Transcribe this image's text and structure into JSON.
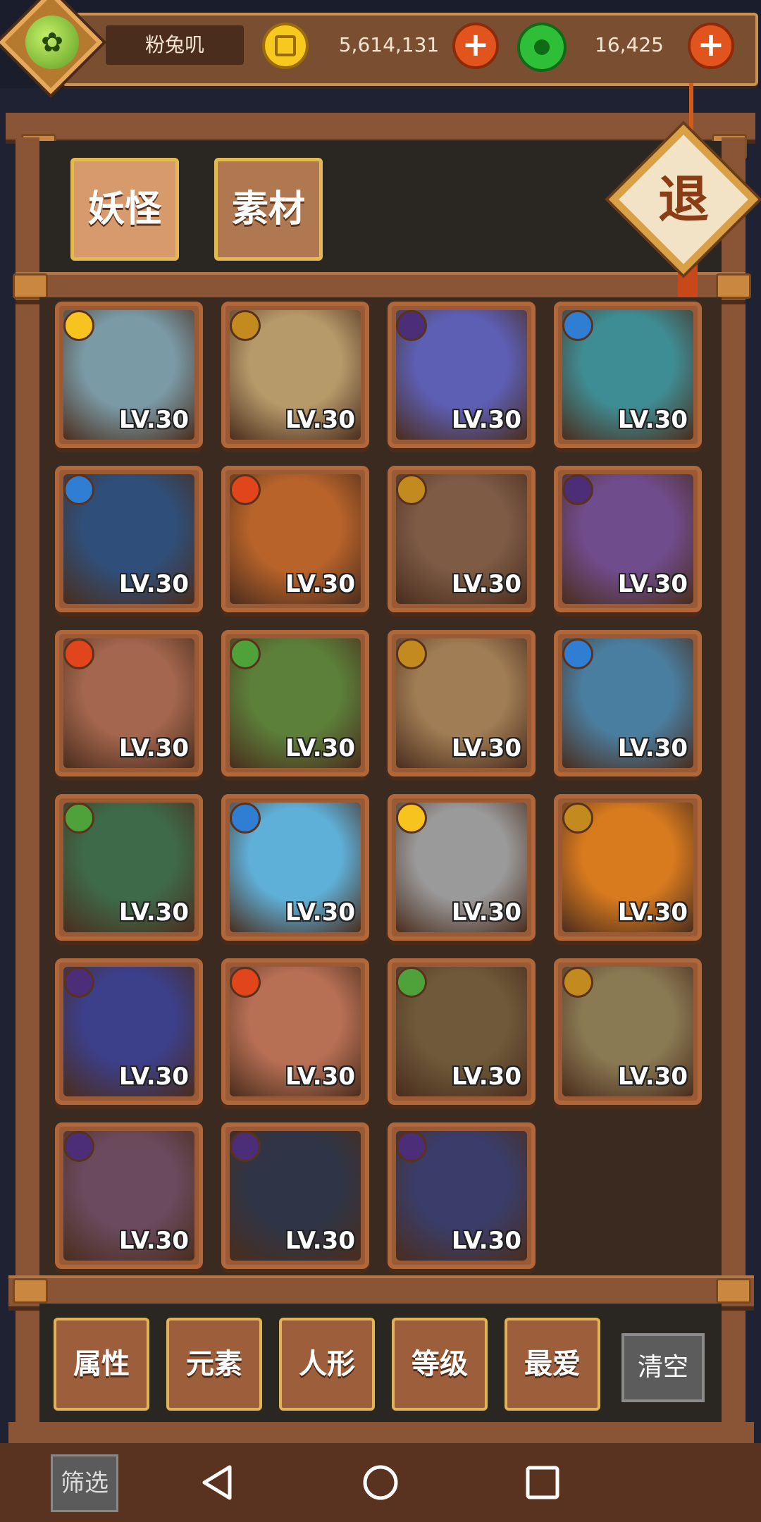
{
  "player": {
    "name": "粉兔叽",
    "avatar_icon": "green-spirit-avatar"
  },
  "resources": {
    "coins": "5,614,131",
    "jade": "16,425",
    "coin_icon": "gold-coin-icon",
    "jade_icon": "green-jade-icon"
  },
  "tabs": [
    {
      "label": "妖怪",
      "active": true
    },
    {
      "label": "素材",
      "active": false
    }
  ],
  "exit_label": "退",
  "monsters": [
    {
      "element": "sun",
      "level": "LV.30",
      "color": "#7a9aa6"
    },
    {
      "element": "earth",
      "level": "LV.30",
      "color": "#b79a6a"
    },
    {
      "element": "moon",
      "level": "LV.30",
      "color": "#5d5fb5"
    },
    {
      "element": "water",
      "level": "LV.30",
      "color": "#3f8d94"
    },
    {
      "element": "water",
      "level": "LV.30",
      "color": "#2f4f7a"
    },
    {
      "element": "fire",
      "level": "LV.30",
      "color": "#b8632a"
    },
    {
      "element": "earth",
      "level": "LV.30",
      "color": "#7d5b45"
    },
    {
      "element": "moon",
      "level": "LV.30",
      "color": "#6f4c8c"
    },
    {
      "element": "fire",
      "level": "LV.30",
      "color": "#a4664e"
    },
    {
      "element": "leaf",
      "level": "LV.30",
      "color": "#5c7f3a"
    },
    {
      "element": "earth",
      "level": "LV.30",
      "color": "#a07d54"
    },
    {
      "element": "water",
      "level": "LV.30",
      "color": "#4a7ea0"
    },
    {
      "element": "leaf",
      "level": "LV.30",
      "color": "#3e6a4a"
    },
    {
      "element": "water",
      "level": "LV.30",
      "color": "#5fb0d9"
    },
    {
      "element": "sun",
      "level": "LV.30",
      "color": "#9a9a9a"
    },
    {
      "element": "earth",
      "level": "LV.30",
      "color": "#d87a1e"
    },
    {
      "element": "moon",
      "level": "LV.30",
      "color": "#3c3f8a"
    },
    {
      "element": "fire",
      "level": "LV.30",
      "color": "#b87055"
    },
    {
      "element": "leaf",
      "level": "LV.30",
      "color": "#6e5a3a"
    },
    {
      "element": "earth",
      "level": "LV.30",
      "color": "#8a7a54"
    },
    {
      "element": "moon",
      "level": "LV.30",
      "color": "#6b4a5e"
    },
    {
      "element": "moon",
      "level": "LV.30",
      "color": "#2f3547"
    },
    {
      "element": "moon",
      "level": "LV.30",
      "color": "#3a3d6a"
    }
  ],
  "filters": [
    "属性",
    "元素",
    "人形",
    "等级",
    "最爱"
  ],
  "clear_label": "清空",
  "filter_tab_label": "筛选",
  "nav_icons": [
    "back-icon",
    "home-icon",
    "recents-icon"
  ]
}
